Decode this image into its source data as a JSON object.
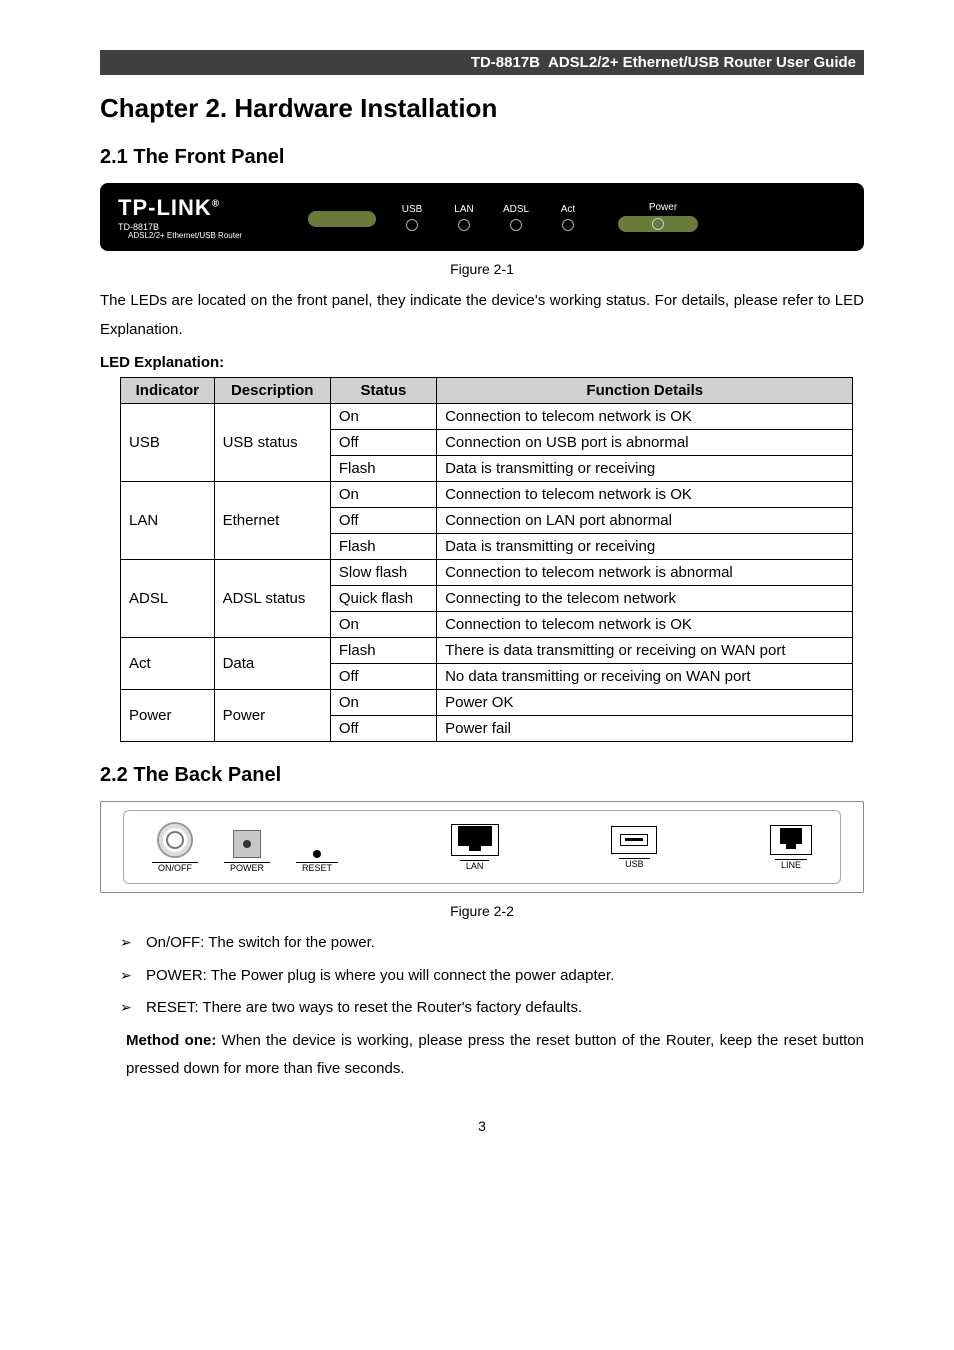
{
  "header": {
    "model": "TD-8817B",
    "title": "ADSL2/2+ Ethernet/USB Router User Guide"
  },
  "chapter": {
    "title": "Chapter 2.  Hardware Installation"
  },
  "sections": {
    "front": {
      "heading": "2.1   The Front Panel",
      "fig_caption": "Figure 2-1",
      "paragraph": "The LEDs are located on the front panel, they indicate the device's working status. For details, please refer to LED Explanation."
    },
    "back": {
      "heading": "2.2   The Back Panel",
      "fig_caption": "Figure 2-2",
      "bullets": [
        "On/OFF: The switch for the power.",
        "POWER: The Power plug is where you will connect the power adapter.",
        "RESET: There are two ways to reset the Router's factory defaults."
      ],
      "method_label": "Method one: ",
      "method_text": "When the device is working, please press the reset button of the Router, keep the reset button pressed down for more than five seconds."
    }
  },
  "front_panel": {
    "brand": "TP-LINK",
    "model": "TD-8817B",
    "sub": "ADSL2/2+ Ethernet/USB Router",
    "leds": [
      "USB",
      "LAN",
      "ADSL",
      "Act",
      "Power"
    ]
  },
  "back_panel": {
    "ports": [
      "ON/OFF",
      "POWER",
      "RESET",
      "LAN",
      "USB",
      "LINE"
    ]
  },
  "led_table": {
    "heading": "LED Explanation:",
    "headers": [
      "Indicator",
      "Description",
      "Status",
      "Function Details"
    ],
    "rows": [
      {
        "indicator": "USB",
        "description": "USB status",
        "items": [
          {
            "status": "On",
            "fn": "Connection to telecom network is OK"
          },
          {
            "status": "Off",
            "fn": "Connection on USB port is abnormal"
          },
          {
            "status": "Flash",
            "fn": "Data is transmitting or receiving"
          }
        ]
      },
      {
        "indicator": "LAN",
        "description": "Ethernet",
        "items": [
          {
            "status": "On",
            "fn": "Connection to telecom network is OK"
          },
          {
            "status": "Off",
            "fn": "Connection on LAN port abnormal"
          },
          {
            "status": "Flash",
            "fn": "Data is transmitting or receiving"
          }
        ]
      },
      {
        "indicator": "ADSL",
        "description": "ADSL status",
        "items": [
          {
            "status": "Slow flash",
            "fn": "Connection to telecom network is abnormal"
          },
          {
            "status": "Quick flash",
            "fn": "Connecting to the telecom network"
          },
          {
            "status": "On",
            "fn": "Connection to telecom network is OK"
          }
        ]
      },
      {
        "indicator": "Act",
        "description": "Data",
        "items": [
          {
            "status": "Flash",
            "fn": "There is data transmitting or receiving on WAN port"
          },
          {
            "status": "Off",
            "fn": "No data transmitting or receiving on WAN port"
          }
        ]
      },
      {
        "indicator": "Power",
        "description": "Power",
        "items": [
          {
            "status": "On",
            "fn": "Power OK"
          },
          {
            "status": "Off",
            "fn": "Power fail"
          }
        ]
      }
    ]
  },
  "page_number": "3"
}
